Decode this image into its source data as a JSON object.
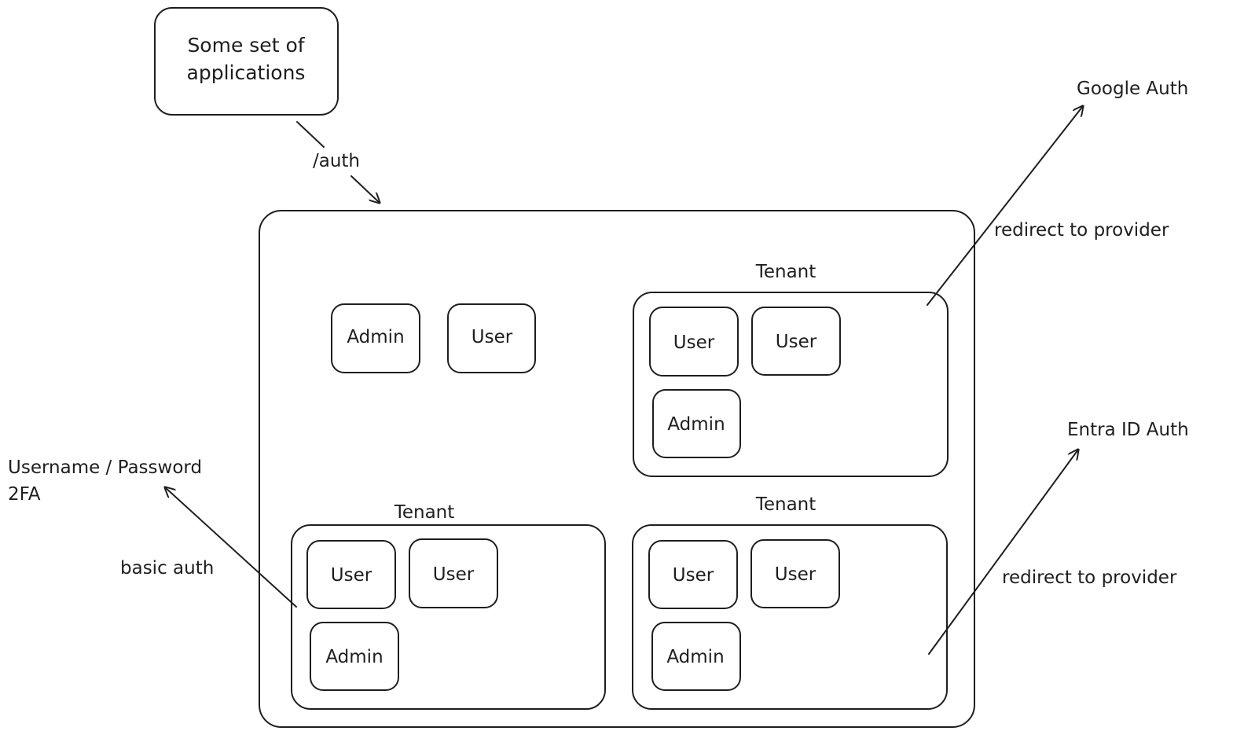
{
  "diagram": {
    "applications": "Some set of",
    "applications_line2": "applications",
    "auth_endpoint_label": "/auth",
    "root_roles": [
      "Admin",
      "User"
    ],
    "tenants": [
      {
        "label": "Tenant",
        "roles": [
          "User",
          "User",
          "Admin"
        ]
      },
      {
        "label": "Tenant",
        "roles": [
          "User",
          "User",
          "Admin"
        ]
      },
      {
        "label": "Tenant",
        "roles": [
          "User",
          "User",
          "Admin"
        ]
      }
    ],
    "providers": {
      "google": {
        "label": "Google Auth",
        "edge_label": "redirect to provider"
      },
      "entra": {
        "label": "Entra ID Auth",
        "edge_label": "redirect to provider"
      },
      "basic": {
        "label_line1": "Username / Password",
        "label_line2": "2FA",
        "edge_label": "basic auth"
      }
    },
    "stroke_color": "#1e1e1e"
  }
}
